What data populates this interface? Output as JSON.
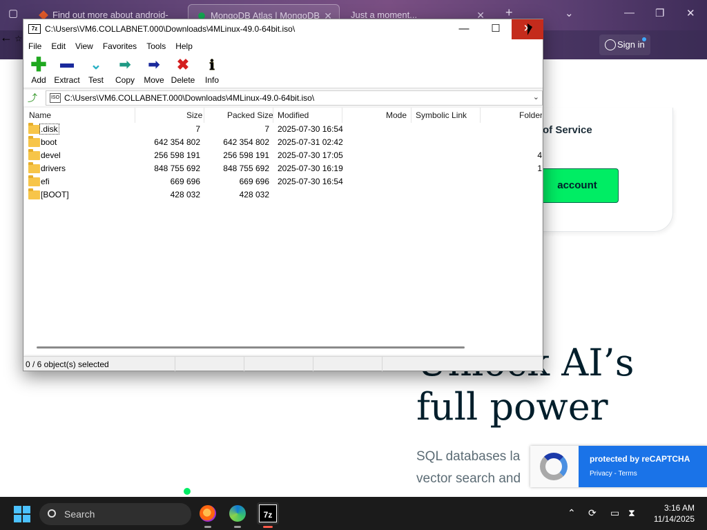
{
  "browser": {
    "tabs": [
      {
        "label": "Find out more about android-"
      },
      {
        "label": "MongoDB Atlas | MongoDB"
      },
      {
        "label": "Just a moment..."
      }
    ],
    "new_tab_glyph": "+",
    "signin_label": "Sign in"
  },
  "webpage": {
    "terms_text": "of Service",
    "account_button": "account",
    "hero_line1": "Unlock AI’s",
    "hero_line2": "full power",
    "subtext_line1": "SQL databases la",
    "subtext_line2": "vector search and",
    "recaptcha_title": "protected by reCAPTCHA",
    "recaptcha_links": "Privacy - Terms"
  },
  "window": {
    "app_icon_text": "7z",
    "title": "C:\\Users\\VM6.COLLABNET.000\\Downloads\\4MLinux-49.0-64bit.iso\\",
    "menu": [
      "File",
      "Edit",
      "View",
      "Favorites",
      "Tools",
      "Help"
    ],
    "toolbar": [
      {
        "label": "Add",
        "icon": "add-icon"
      },
      {
        "label": "Extract",
        "icon": "extract-icon"
      },
      {
        "label": "Test",
        "icon": "test-icon"
      },
      {
        "label": "Copy",
        "icon": "copy-icon"
      },
      {
        "label": "Move",
        "icon": "move-icon"
      },
      {
        "label": "Delete",
        "icon": "delete-icon"
      },
      {
        "label": "Info",
        "icon": "info-icon"
      }
    ],
    "address": "C:\\Users\\VM6.COLLABNET.000\\Downloads\\4MLinux-49.0-64bit.iso\\",
    "columns": [
      "Name",
      "Size",
      "Packed Size",
      "Modified",
      "Mode",
      "Symbolic Link",
      "Folder"
    ],
    "rows": [
      {
        "name": ".disk",
        "size": "7",
        "packed": "7",
        "modified": "2025-07-30 16:54",
        "folders": ""
      },
      {
        "name": "boot",
        "size": "642 354 802",
        "packed": "642 354 802",
        "modified": "2025-07-31 02:42",
        "folders": ""
      },
      {
        "name": "devel",
        "size": "256 598 191",
        "packed": "256 598 191",
        "modified": "2025-07-30 17:05",
        "folders": "4"
      },
      {
        "name": "drivers",
        "size": "848 755 692",
        "packed": "848 755 692",
        "modified": "2025-07-30 16:19",
        "folders": "1"
      },
      {
        "name": "efi",
        "size": "669 696",
        "packed": "669 696",
        "modified": "2025-07-30 16:54",
        "folders": ""
      },
      {
        "name": "[BOOT]",
        "size": "428 032",
        "packed": "428 032",
        "modified": "",
        "folders": ""
      }
    ],
    "status": "0 / 6 object(s) selected"
  },
  "taskbar": {
    "search_placeholder": "Search",
    "time": "3:16 AM",
    "date": "11/14/2025",
    "sevenzip_label": "7z"
  },
  "colors": {
    "close_button": "#c42b1c",
    "mongo_green": "#00ed64",
    "recaptcha_blue": "#1a73e8",
    "folder_yellow": "#f7c549"
  }
}
